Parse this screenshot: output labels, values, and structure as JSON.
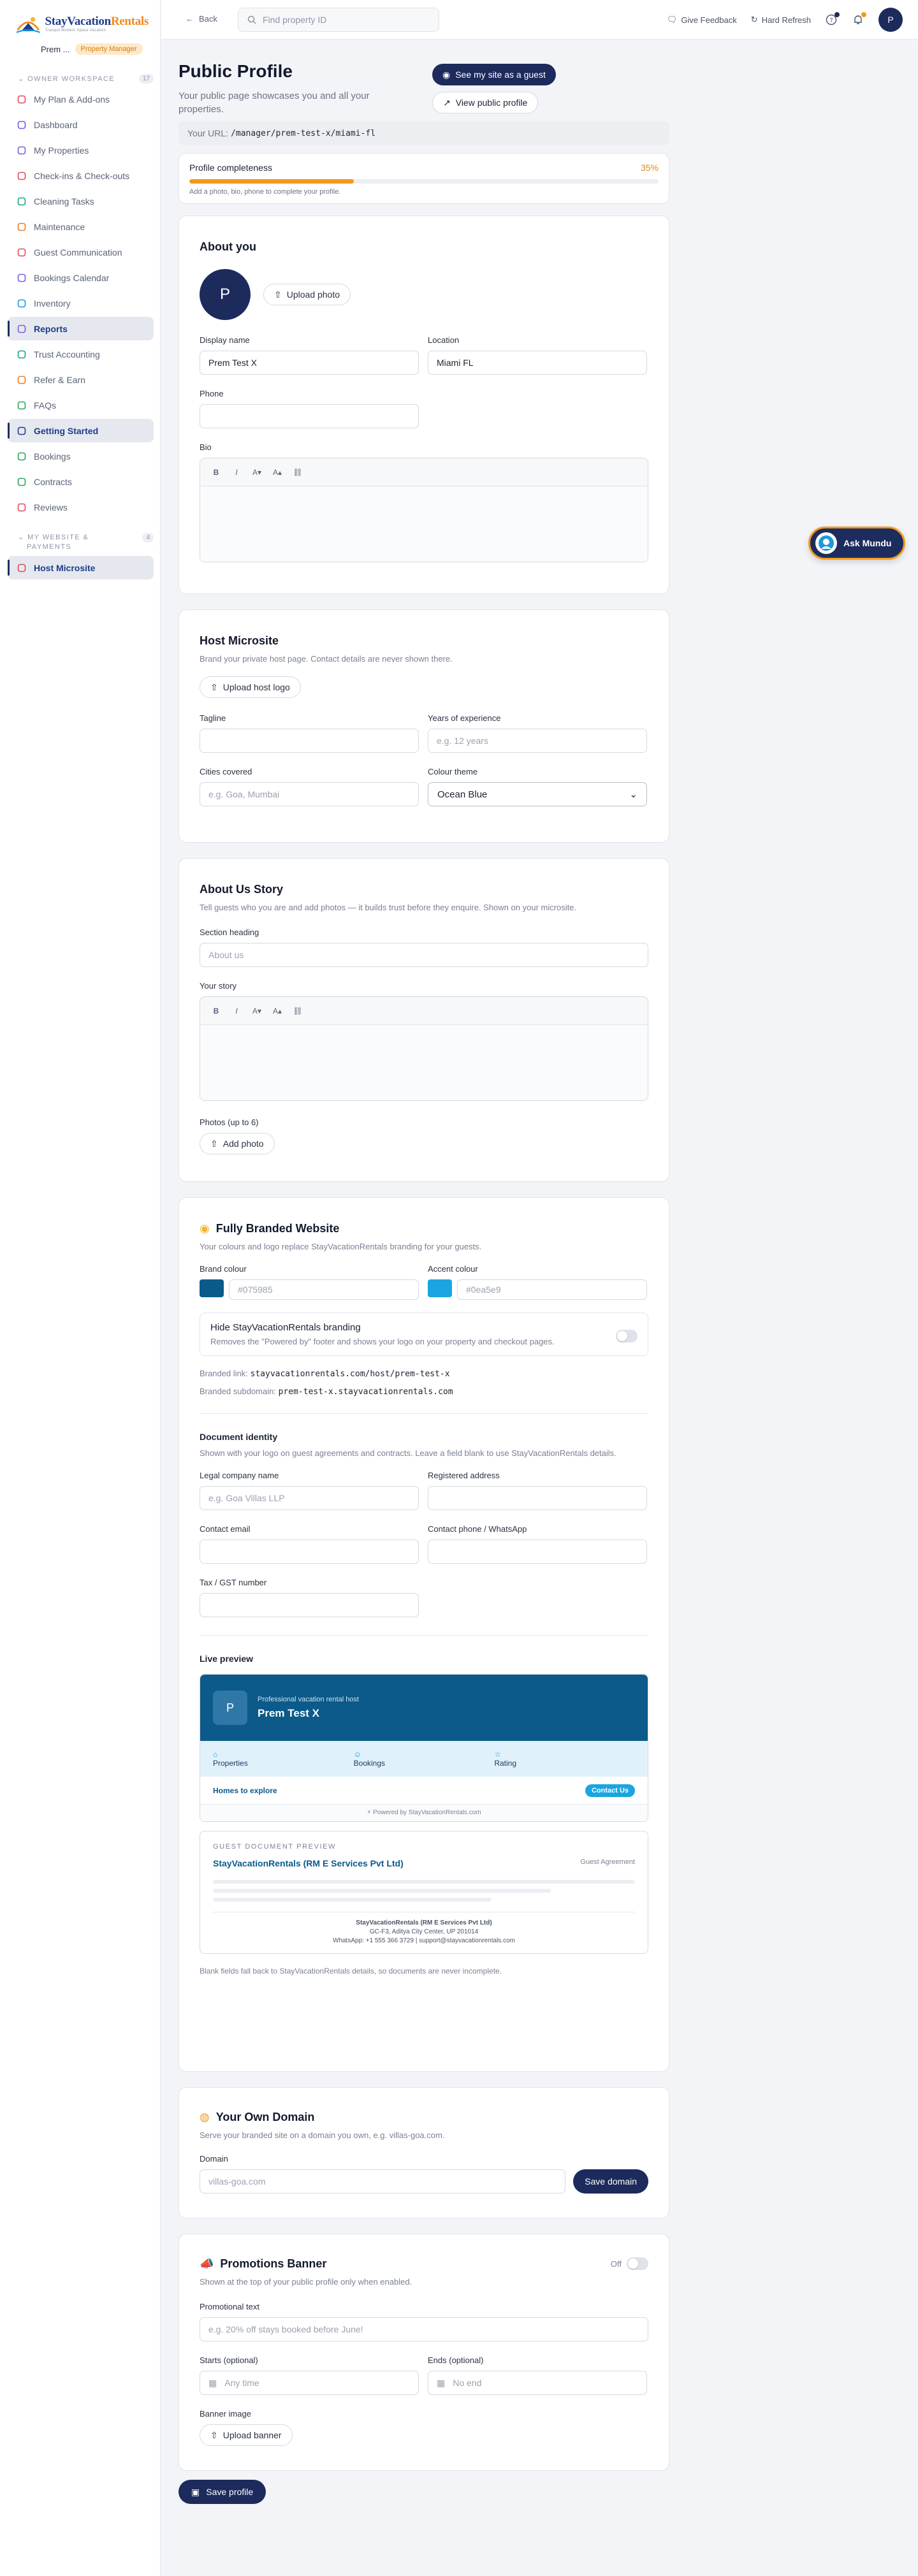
{
  "brand": {
    "name": "StayVacation",
    "name2": "Rentals",
    "tagline": "Tranquil Modern Space Vacation"
  },
  "user": {
    "name": "Prem ...",
    "role": "Property Manager",
    "initial": "P"
  },
  "sidebar": {
    "section1": "OWNER WORKSPACE",
    "section1_count": "17",
    "items1": [
      {
        "label": "My Plan & Add-ons",
        "color": "#e2495c"
      },
      {
        "label": "Dashboard",
        "color": "#7a5ae0"
      },
      {
        "label": "My Properties",
        "color": "#7a5ae0"
      },
      {
        "label": "Check-ins & Check-outs",
        "color": "#e2495c"
      },
      {
        "label": "Cleaning Tasks",
        "color": "#17a38a"
      },
      {
        "label": "Maintenance",
        "color": "#ee7a20"
      },
      {
        "label": "Guest Communication",
        "color": "#e2495c"
      },
      {
        "label": "Bookings Calendar",
        "color": "#7a5ae0"
      },
      {
        "label": "Inventory",
        "color": "#1e9ad6"
      },
      {
        "label": "Reports",
        "color": "#7a5ae0"
      },
      {
        "label": "Trust Accounting",
        "color": "#17a38a"
      },
      {
        "label": "Refer & Earn",
        "color": "#ee7a20"
      },
      {
        "label": "FAQs",
        "color": "#2aa35a"
      },
      {
        "label": "Getting Started",
        "color": "#1f3c8a"
      },
      {
        "label": "Bookings",
        "color": "#2aa35a"
      },
      {
        "label": "Contracts",
        "color": "#2aa35a"
      },
      {
        "label": "Reviews",
        "color": "#e2495c"
      }
    ],
    "section2a": "MY WEBSITE &",
    "section2b": "PAYMENTS",
    "section2_count": "4",
    "items2": [
      {
        "label": "Host Microsite",
        "color": "#e2495c"
      }
    ]
  },
  "topbar": {
    "back": "Back",
    "search_placeholder": "Find property ID",
    "feedback": "Give Feedback",
    "refresh": "Hard Refresh"
  },
  "header": {
    "title": "Public Profile",
    "subtitle": "Your public page showcases you and all your properties.",
    "see_guest": "See my site as a guest",
    "view_public": "View public profile"
  },
  "url": {
    "label": "Your URL:",
    "value": "/manager/prem-test-x/miami-fl"
  },
  "completeness": {
    "label": "Profile completeness",
    "pct_text": "35%",
    "value": 0.35,
    "hint": "Add a photo, bio, phone to complete your profile."
  },
  "about": {
    "title": "About you",
    "upload": "Upload photo",
    "display_name_label": "Display name",
    "display_name": "Prem Test X",
    "location_label": "Location",
    "location": "Miami FL",
    "phone_label": "Phone",
    "phone": "",
    "bio_label": "Bio"
  },
  "microsite": {
    "title": "Host Microsite",
    "desc": "Brand your private host page. Contact details are never shown there.",
    "upload": "Upload host logo",
    "tagline_label": "Tagline",
    "years_label": "Years of experience",
    "years_ph": "e.g. 12 years",
    "cities_label": "Cities covered",
    "cities_ph": "e.g. Goa, Mumbai",
    "theme_label": "Colour theme",
    "theme": "Ocean Blue"
  },
  "story": {
    "title": "About Us Story",
    "desc": "Tell guests who you are and add photos — it builds trust before they enquire. Shown on your microsite.",
    "heading_label": "Section heading",
    "heading_ph": "About us",
    "story_label": "Your story",
    "photos_label": "Photos (up to 6)",
    "add_photo": "Add photo"
  },
  "branded": {
    "title": "Fully Branded Website",
    "desc": "Your colours and logo replace StayVacationRentals branding for your guests.",
    "brand_label": "Brand colour",
    "brand_color": "#0b5a8a",
    "brand_ph": "#075985",
    "accent_label": "Accent colour",
    "accent_color": "#1aa5e0",
    "accent_ph": "#0ea5e9",
    "hide_title": "Hide StayVacationRentals branding",
    "hide_desc": "Removes the \"Powered by\" footer and shows your logo on your property and checkout pages.",
    "link_label": "Branded link:",
    "link": "stayvacationrentals.com/host/prem-test-x",
    "sub_label": "Branded subdomain:",
    "sub": "prem-test-x.stayvacationrentals.com",
    "doc_title": "Document identity",
    "doc_desc": "Shown with your logo on guest agreements and contracts. Leave a field blank to use StayVacationRentals details.",
    "company_label": "Legal company name",
    "company_ph": "e.g. Goa Villas LLP",
    "address_label": "Registered address",
    "email_label": "Contact email",
    "phone_label": "Contact phone / WhatsApp",
    "tax_label": "Tax / GST number",
    "preview_title": "Live preview",
    "pv_initial": "P",
    "pv_tag": "Professional vacation rental host",
    "pv_name": "Prem Test X",
    "pv_stat1": "Properties",
    "pv_stat2": "Bookings",
    "pv_stat3": "Rating",
    "pv_homes": "Homes to explore",
    "pv_contact": "Contact Us",
    "pv_powered": "⚡ Powered by StayVacationRentals.com",
    "doc_preview": "GUEST DOCUMENT PREVIEW",
    "doc_company": "StayVacationRentals (RM E Services Pvt Ltd)",
    "doc_type": "Guest Agreement",
    "doc_f1": "StayVacationRentals (RM E Services Pvt Ltd)",
    "doc_f2": "GC-F3, Aditya City Center, UP 201014",
    "doc_f3": "WhatsApp: +1 555 366 3729 | support@stayvacationrentals.com",
    "note": "Blank fields fall back to StayVacationRentals details, so documents are never incomplete."
  },
  "domain": {
    "title": "Your Own Domain",
    "desc": "Serve your branded site on a domain you own, e.g. villas-goa.com.",
    "label": "Domain",
    "ph": "villas-goa.com",
    "save": "Save domain"
  },
  "promo": {
    "title": "Promotions Banner",
    "desc": "Shown at the top of your public profile only when enabled.",
    "state": "Off",
    "text_label": "Promotional text",
    "text_ph": "e.g. 20% off stays booked before June!",
    "starts_label": "Starts (optional)",
    "starts_ph": "Any time",
    "ends_label": "Ends (optional)",
    "ends_ph": "No end",
    "banner_label": "Banner image",
    "upload": "Upload banner"
  },
  "save": "Save profile",
  "ask": "Ask Mundu"
}
